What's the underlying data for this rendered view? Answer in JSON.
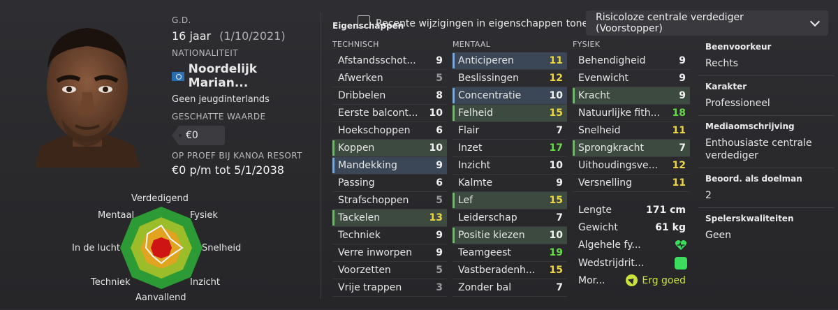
{
  "bio": {
    "dob_label": "G.D.",
    "age": "16 jaar",
    "dob": "(1/10/2021)",
    "nationality_label": "NATIONALITEIT",
    "nationality": "Noordelijk Marian...",
    "youth_caps": "Geen jeugdinterlands",
    "value_label": "GESCHATTE WAARDE",
    "value": "€0",
    "contract_label": "OP PROEF BIJ KANOA RESORT",
    "contract": "€0 p/m tot 5/1/2038"
  },
  "radar": {
    "labels": {
      "top": "Verdedigend",
      "topright": "Fysiek",
      "right": "Snelheid",
      "bottomright": "Inzicht",
      "bottom": "Aanvallend",
      "bottomleft": "Techniek",
      "left": "In de lucht",
      "topleft": "Mentaal"
    }
  },
  "toolbar": {
    "tab_title": "Eigenschappen",
    "checkbox_label": "Recente wijzigingen in eigenschappen tonen",
    "role_dropdown": "Risicoloze centrale verdediger (Voorstopper)"
  },
  "columns": {
    "technical": {
      "header": "TECHNISCH",
      "items": [
        {
          "name": "Afstandsschot...",
          "value": "9",
          "color": "white",
          "hl": ""
        },
        {
          "name": "Afwerken",
          "value": "5",
          "color": "grey",
          "hl": ""
        },
        {
          "name": "Dribbelen",
          "value": "8",
          "color": "white",
          "hl": ""
        },
        {
          "name": "Eerste balcont...",
          "value": "10",
          "color": "white",
          "hl": ""
        },
        {
          "name": "Hoekschoppen",
          "value": "6",
          "color": "white",
          "hl": ""
        },
        {
          "name": "Koppen",
          "value": "10",
          "color": "white",
          "hl": "green"
        },
        {
          "name": "Mandekking",
          "value": "9",
          "color": "white",
          "hl": "blue"
        },
        {
          "name": "Passing",
          "value": "6",
          "color": "white",
          "hl": ""
        },
        {
          "name": "Strafschoppen",
          "value": "5",
          "color": "grey",
          "hl": ""
        },
        {
          "name": "Tackelen",
          "value": "13",
          "color": "yellow",
          "hl": "green"
        },
        {
          "name": "Techniek",
          "value": "9",
          "color": "white",
          "hl": ""
        },
        {
          "name": "Verre inworpen",
          "value": "9",
          "color": "white",
          "hl": ""
        },
        {
          "name": "Voorzetten",
          "value": "5",
          "color": "grey",
          "hl": ""
        },
        {
          "name": "Vrije trappen",
          "value": "3",
          "color": "grey",
          "hl": ""
        }
      ]
    },
    "mental": {
      "header": "MENTAAL",
      "items": [
        {
          "name": "Anticiperen",
          "value": "11",
          "color": "yellow",
          "hl": "blue"
        },
        {
          "name": "Beslissingen",
          "value": "12",
          "color": "yellow",
          "hl": ""
        },
        {
          "name": "Concentratie",
          "value": "10",
          "color": "white",
          "hl": "blue"
        },
        {
          "name": "Felheid",
          "value": "15",
          "color": "yellow",
          "hl": "green"
        },
        {
          "name": "Flair",
          "value": "7",
          "color": "white",
          "hl": ""
        },
        {
          "name": "Inzet",
          "value": "17",
          "color": "green",
          "hl": ""
        },
        {
          "name": "Inzicht",
          "value": "10",
          "color": "white",
          "hl": ""
        },
        {
          "name": "Kalmte",
          "value": "9",
          "color": "white",
          "hl": ""
        },
        {
          "name": "Lef",
          "value": "15",
          "color": "yellow",
          "hl": "green"
        },
        {
          "name": "Leiderschap",
          "value": "7",
          "color": "white",
          "hl": ""
        },
        {
          "name": "Positie kiezen",
          "value": "10",
          "color": "white",
          "hl": "green"
        },
        {
          "name": "Teamgeest",
          "value": "19",
          "color": "green",
          "hl": ""
        },
        {
          "name": "Vastberadenh...",
          "value": "15",
          "color": "yellow",
          "hl": ""
        },
        {
          "name": "Zonder bal",
          "value": "7",
          "color": "white",
          "hl": ""
        }
      ]
    },
    "physical": {
      "header": "FYSIEK",
      "items": [
        {
          "name": "Behendigheid",
          "value": "9",
          "color": "white",
          "hl": ""
        },
        {
          "name": "Evenwicht",
          "value": "9",
          "color": "white",
          "hl": ""
        },
        {
          "name": "Kracht",
          "value": "9",
          "color": "white",
          "hl": "green"
        },
        {
          "name": "Natuurlijke fith...",
          "value": "18",
          "color": "green",
          "hl": ""
        },
        {
          "name": "Snelheid",
          "value": "11",
          "color": "yellow",
          "hl": ""
        },
        {
          "name": "Sprongkracht",
          "value": "7",
          "color": "white",
          "hl": "green"
        },
        {
          "name": "Uithoudingsve...",
          "value": "12",
          "color": "yellow",
          "hl": ""
        },
        {
          "name": "Versnelling",
          "value": "11",
          "color": "yellow",
          "hl": ""
        }
      ]
    }
  },
  "physinfo": {
    "height_label": "Lengte",
    "height": "171 cm",
    "weight_label": "Gewicht",
    "weight": "61 kg",
    "fitness_label": "Algehele fy...",
    "match_label": "Wedstrijdrit...",
    "morale_label": "Mor...",
    "morale": "Erg goed"
  },
  "right": {
    "foot_title": "Beenvoorkeur",
    "foot": "Rechts",
    "character_title": "Karakter",
    "character": "Professioneel",
    "media_title": "Mediaomschrijving",
    "media": "Enthousiaste centrale verdediger",
    "gk_title": "Beoord. als doelman",
    "gk": "2",
    "qualities_title": "Spelerskwaliteiten",
    "qualities": "Geen"
  },
  "colors": {
    "grey": "#9a9a9e",
    "white": "#f2f2f2",
    "yellow": "#ecd64a",
    "green": "#6ad94a"
  }
}
